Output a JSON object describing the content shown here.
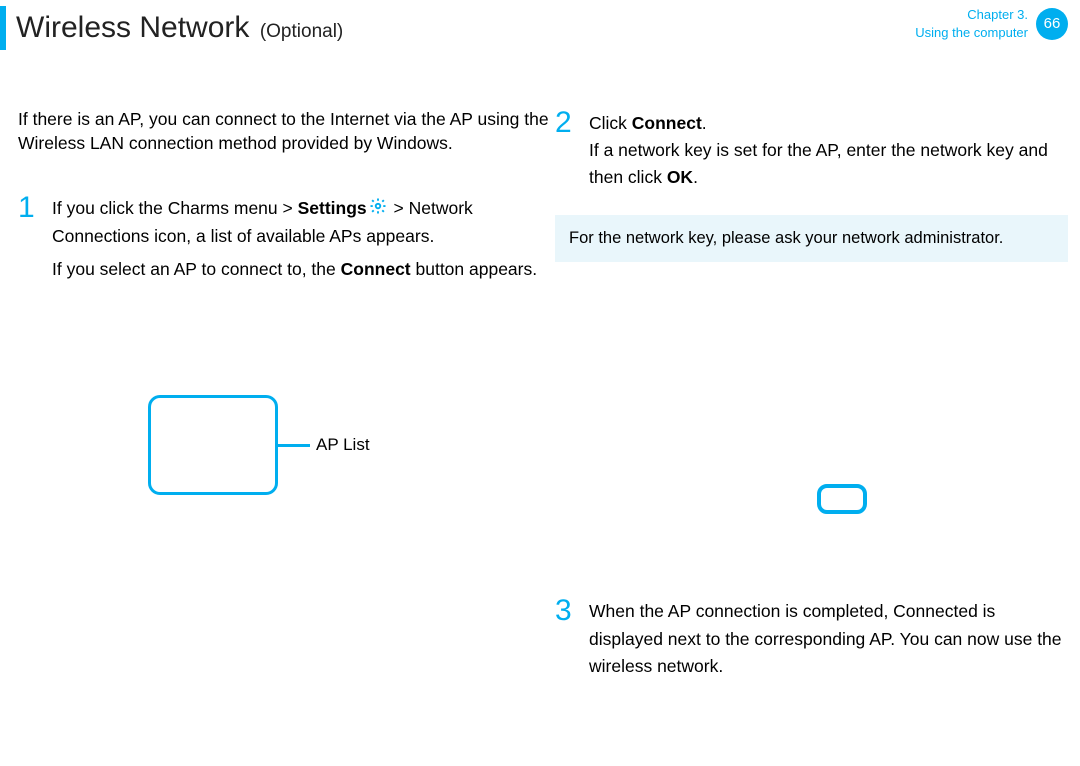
{
  "header": {
    "title_main": "Wireless Network",
    "title_sub": "(Optional)",
    "chapter_line1": "Chapter 3.",
    "chapter_line2": "Using the computer",
    "page_number": "66"
  },
  "left": {
    "intro": "If there is an AP, you can connect to the Internet via the AP using the Wireless LAN connection method provided by Windows.",
    "step1": {
      "num": "1",
      "line1a": "If you click the Charms menu > ",
      "line1b_bold": "Settings",
      "line1c": " > Network ",
      "line2a": "Connections ",
      "line2b": " icon, a list of available APs appears.",
      "line3": "If you select an AP to connect to, the ",
      "line3_bold": "Connect",
      "line3_after": " button appears."
    },
    "ap_label": "AP List"
  },
  "right": {
    "step2": {
      "num": "2",
      "line1": "Click ",
      "line1_bold": "Connect",
      "line1_after": ".",
      "line2": "If a network key is set for the AP, enter the network key and then click ",
      "line2_bold": "OK",
      "line2_after": "."
    },
    "note": "For the network key, please ask your network administrator.",
    "step3": {
      "num": "3",
      "text": "When the AP connection is completed, Connected is displayed next to the corresponding AP. You can now use the wireless network."
    }
  }
}
